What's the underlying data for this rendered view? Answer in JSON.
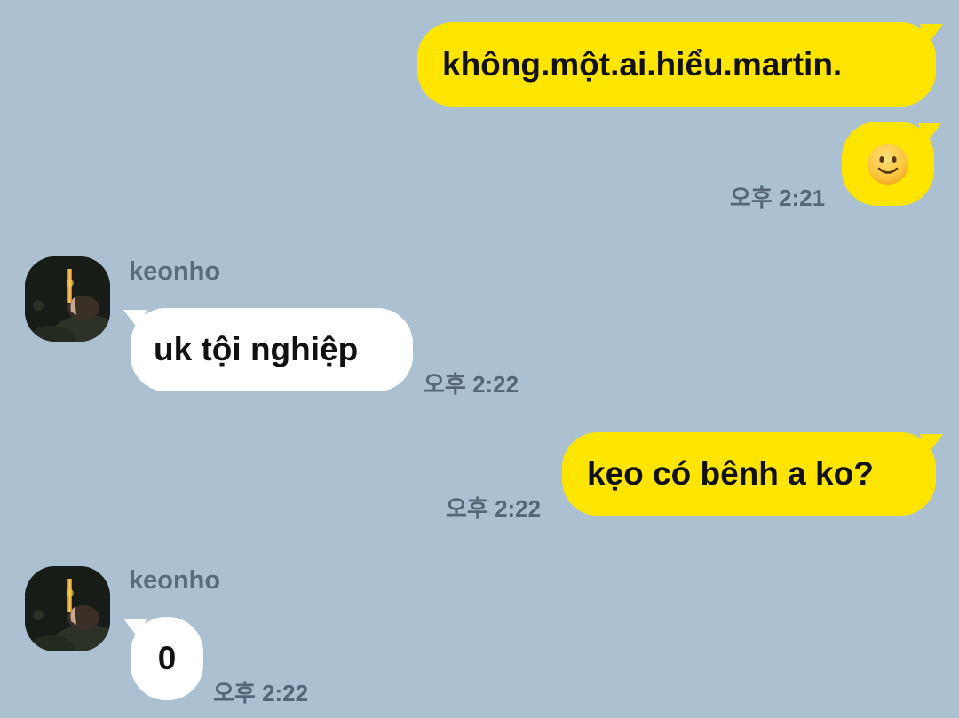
{
  "colors": {
    "background": "#abc1d1",
    "my_bubble": "#fee500",
    "their_bubble": "#ffffff",
    "timestamp": "#556675",
    "sender_name": "#5a6b79"
  },
  "messages": [
    {
      "sender": "me",
      "text": "không.một.ai.hiểu.martin."
    },
    {
      "sender": "me",
      "emoji": "slightly-smiling-face-icon",
      "time": "오후 2:21"
    },
    {
      "sender": "them",
      "name": "keonho",
      "text": "uk tội nghiệp",
      "time": "오후 2:22"
    },
    {
      "sender": "me",
      "text": "kẹo có bênh a ko?",
      "time": "오후 2:22"
    },
    {
      "sender": "them",
      "name": "keonho",
      "text": "0",
      "time": "오후 2:22"
    }
  ]
}
